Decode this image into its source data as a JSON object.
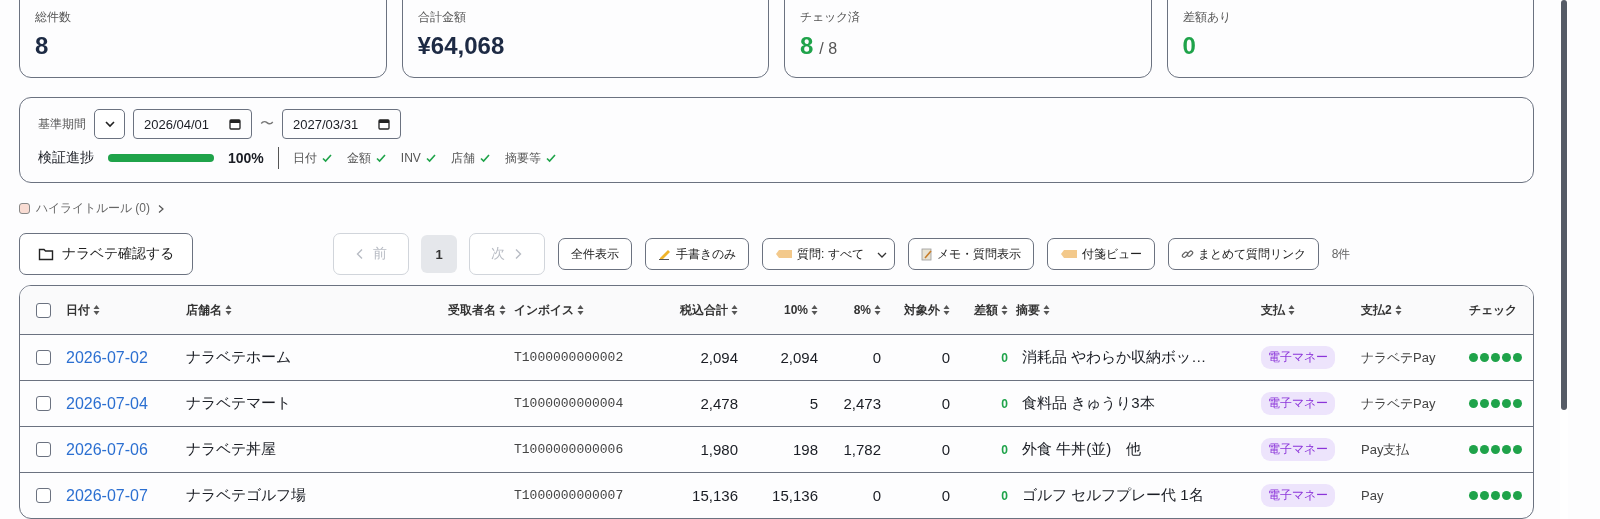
{
  "summary_cards": [
    {
      "label": "総件数",
      "value": "8",
      "kind": "plain"
    },
    {
      "label": "合計金額",
      "value": "¥64,068",
      "kind": "plain"
    },
    {
      "label": "チェック済",
      "value": "8",
      "total": "/ 8",
      "kind": "good"
    },
    {
      "label": "差額あり",
      "value": "0",
      "kind": "good"
    }
  ],
  "filter": {
    "period_label": "基準期間",
    "start_date": "2026/04/01",
    "separator": "〜",
    "end_date": "2027/03/31",
    "progress_label": "検証進捗",
    "level": 1,
    "progress_text": "100%",
    "criteria": [
      {
        "label": "日付",
        "checked": true
      },
      {
        "label": "金額",
        "checked": true
      },
      {
        "label": "INV",
        "checked": true
      },
      {
        "label": "店舗",
        "checked": true
      },
      {
        "label": "摘要等",
        "checked": true
      }
    ]
  },
  "highlight_rules": {
    "label": "ハイライトルール (0)",
    "color": "#f9dcd3",
    "expanded": false
  },
  "toolbar": {
    "confirm_button": "ナラベテ確認する",
    "pagination": {
      "prev": {
        "label": "前",
        "disabled": true
      },
      "pages": [
        {
          "label": "1",
          "selected": true
        }
      ],
      "next": {
        "label": "次",
        "disabled": true
      }
    },
    "buttons": [
      {
        "label": "全件表示",
        "kind": "button"
      },
      {
        "label": "手書きのみ",
        "kind": "button"
      },
      {
        "label": "質問: すべて",
        "kind": "select"
      },
      {
        "label": "メモ・質問表示",
        "kind": "button"
      },
      {
        "label": "付箋ビュー",
        "kind": "button"
      },
      {
        "label": "まとめて質問リンク",
        "kind": "button"
      }
    ],
    "count": "8件"
  },
  "table": {
    "all_checked": false,
    "columns": [
      {
        "label": "日付",
        "sortable": true
      },
      {
        "label": "店舗名",
        "sortable": true
      },
      {
        "label": "受取者名",
        "sortable": true
      },
      {
        "label": "インボイス",
        "sortable": true
      },
      {
        "label": "税込合計",
        "sortable": true
      },
      {
        "label": "10%",
        "sortable": true
      },
      {
        "label": "8%",
        "sortable": true
      },
      {
        "label": "対象外",
        "sortable": true
      },
      {
        "label": "差額",
        "sortable": true
      },
      {
        "label": "摘要",
        "sortable": true
      },
      {
        "label": "支払",
        "sortable": true
      },
      {
        "label": "支払2",
        "sortable": true
      },
      {
        "label": "チェック",
        "sortable": false
      }
    ],
    "rows": [
      {
        "checked": false,
        "date": "2026-07-02",
        "store": "ナラベテホーム",
        "invoice": "T1000000000002",
        "total": "2,094",
        "rate10": "2,094",
        "rate8": "0",
        "exempt": "0",
        "diff": "0",
        "summary": "消耗品 やわらか収納ボッ…",
        "payment": "電子マネー",
        "payment2": "ナラベテPay",
        "checks": [
          true,
          true,
          true,
          true,
          true
        ]
      },
      {
        "checked": false,
        "date": "2026-07-04",
        "store": "ナラベテマート",
        "invoice": "T1000000000004",
        "total": "2,478",
        "rate10": "5",
        "rate8": "2,473",
        "exempt": "0",
        "diff": "0",
        "summary": "食料品 きゅうり3本",
        "payment": "電子マネー",
        "payment2": "ナラベテPay",
        "checks": [
          true,
          true,
          true,
          true,
          true
        ]
      },
      {
        "checked": false,
        "date": "2026-07-06",
        "store": "ナラベテ丼屋",
        "invoice": "T1000000000006",
        "total": "1,980",
        "rate10": "198",
        "rate8": "1,782",
        "exempt": "0",
        "diff": "0",
        "summary": "外食 牛丼(並)　他",
        "payment": "電子マネー",
        "payment2": "Pay支払",
        "checks": [
          true,
          true,
          true,
          true,
          true
        ]
      },
      {
        "checked": false,
        "date": "2026-07-07",
        "store": "ナラベテゴルフ場",
        "invoice": "T1000000000007",
        "total": "15,136",
        "rate10": "15,136",
        "rate8": "0",
        "exempt": "0",
        "diff": "0",
        "summary": "ゴルフ セルフプレー代 1名",
        "payment": "電子マネー",
        "payment2": "Pay",
        "checks": [
          true,
          true,
          true,
          true,
          true
        ]
      }
    ]
  }
}
